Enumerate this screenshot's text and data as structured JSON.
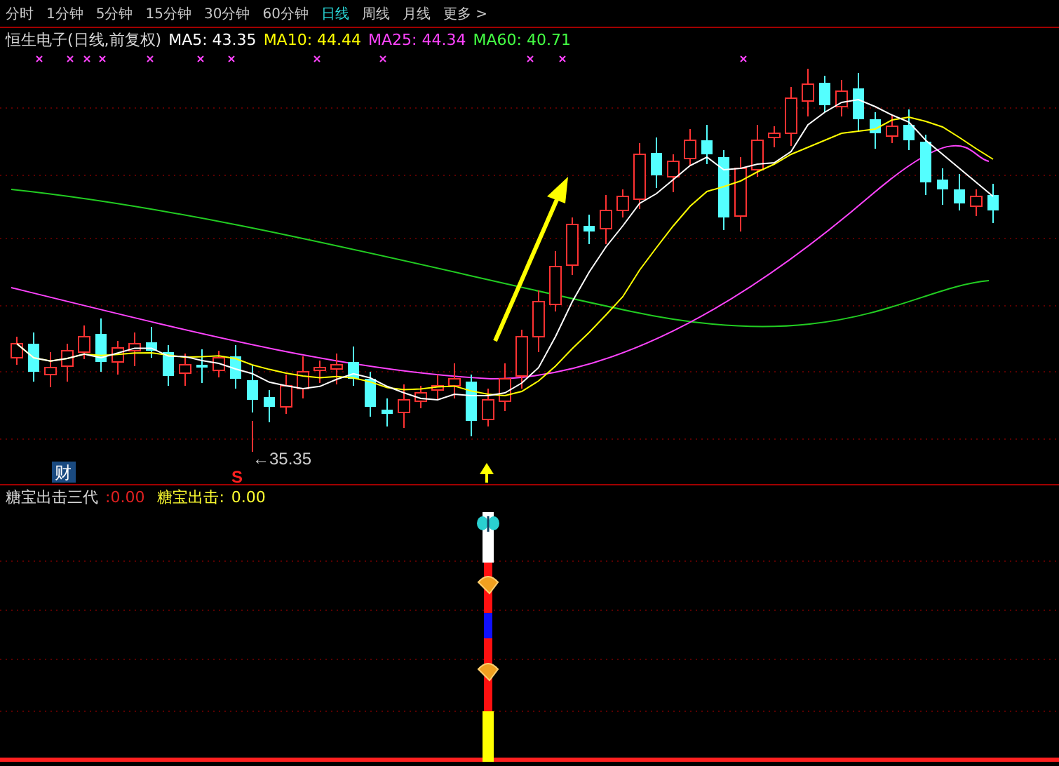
{
  "period_tabs": [
    {
      "label": "分时",
      "selected": false
    },
    {
      "label": "1分钟",
      "selected": false
    },
    {
      "label": "5分钟",
      "selected": false
    },
    {
      "label": "15分钟",
      "selected": false
    },
    {
      "label": "30分钟",
      "selected": false
    },
    {
      "label": "60分钟",
      "selected": false
    },
    {
      "label": "日线",
      "selected": true
    },
    {
      "label": "周线",
      "selected": false
    },
    {
      "label": "月线",
      "selected": false
    },
    {
      "label": "更多 >",
      "selected": false
    }
  ],
  "main_chart": {
    "title": "恒生电子(日线,前复权)",
    "moving_averages": [
      {
        "name": "MA5:",
        "value": "43.35",
        "color": "#ffffff"
      },
      {
        "name": "MA10:",
        "value": "44.44",
        "color": "#ffff00"
      },
      {
        "name": "MA25:",
        "value": "44.34",
        "color": "#ff44ff"
      },
      {
        "name": "MA60:",
        "value": "40.71",
        "color": "#44ff44"
      }
    ],
    "finance_marker": "财",
    "signal_marker": "S",
    "low_price_label": "←35.35"
  },
  "indicator_panel": {
    "name": "糖宝出击三代",
    "value_1": ":0.00",
    "label_2": "糖宝出击:",
    "value_2": "0.00"
  }
}
